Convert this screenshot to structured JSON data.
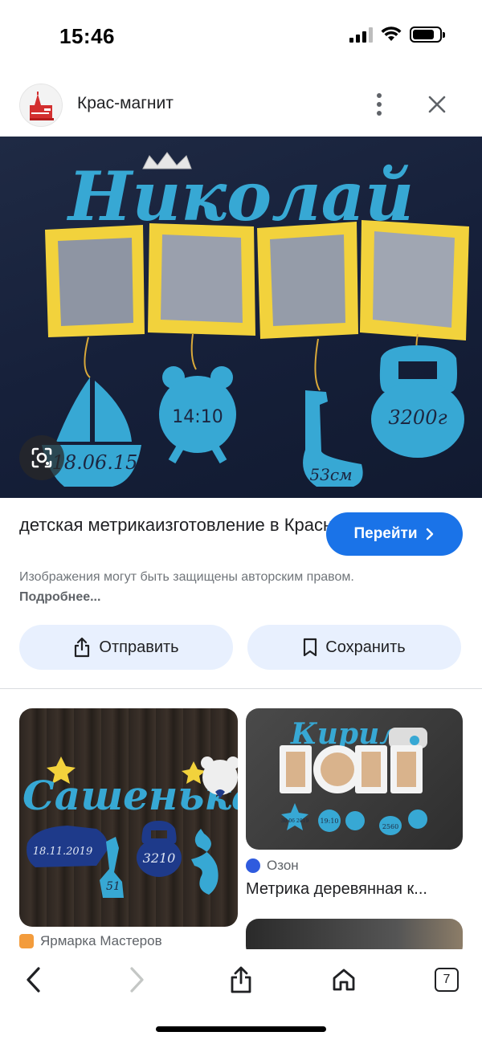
{
  "status_bar": {
    "time": "15:46",
    "battery_level": 0.8
  },
  "header": {
    "site_name": "Крас-магнит"
  },
  "hero": {
    "name_text": "Николай",
    "tags": [
      "18.06.15",
      "14:10",
      "53см",
      "3200г"
    ],
    "colors": {
      "background": "#1c2640",
      "accent_blue": "#37a8d4",
      "frame_yellow": "#f2d23c"
    }
  },
  "result": {
    "title_line1": "детская метрика",
    "title_line2": "изготовление в Красноярск...",
    "visit_label": "Перейти",
    "copyright_text": "Изображения могут быть защищены авторским правом.",
    "more_link": "Подробнее..."
  },
  "actions": {
    "share_label": "Отправить",
    "save_label": "Сохранить"
  },
  "grid": {
    "card1": {
      "image_text": "Сашенька",
      "tags": [
        "18.11.2019",
        "51",
        "3210"
      ],
      "source": "Ярмарка Мастеров"
    },
    "card2": {
      "image_text": "Кирилл",
      "tags": [
        "30.06 2019",
        "19:10",
        "2560"
      ],
      "source": "Озон",
      "title": "Метрика деревянная к..."
    }
  },
  "toolbar": {
    "tabs_count": "7"
  },
  "colors": {
    "accent": "#1a73e8",
    "pill_bg": "#e8f0fe"
  }
}
